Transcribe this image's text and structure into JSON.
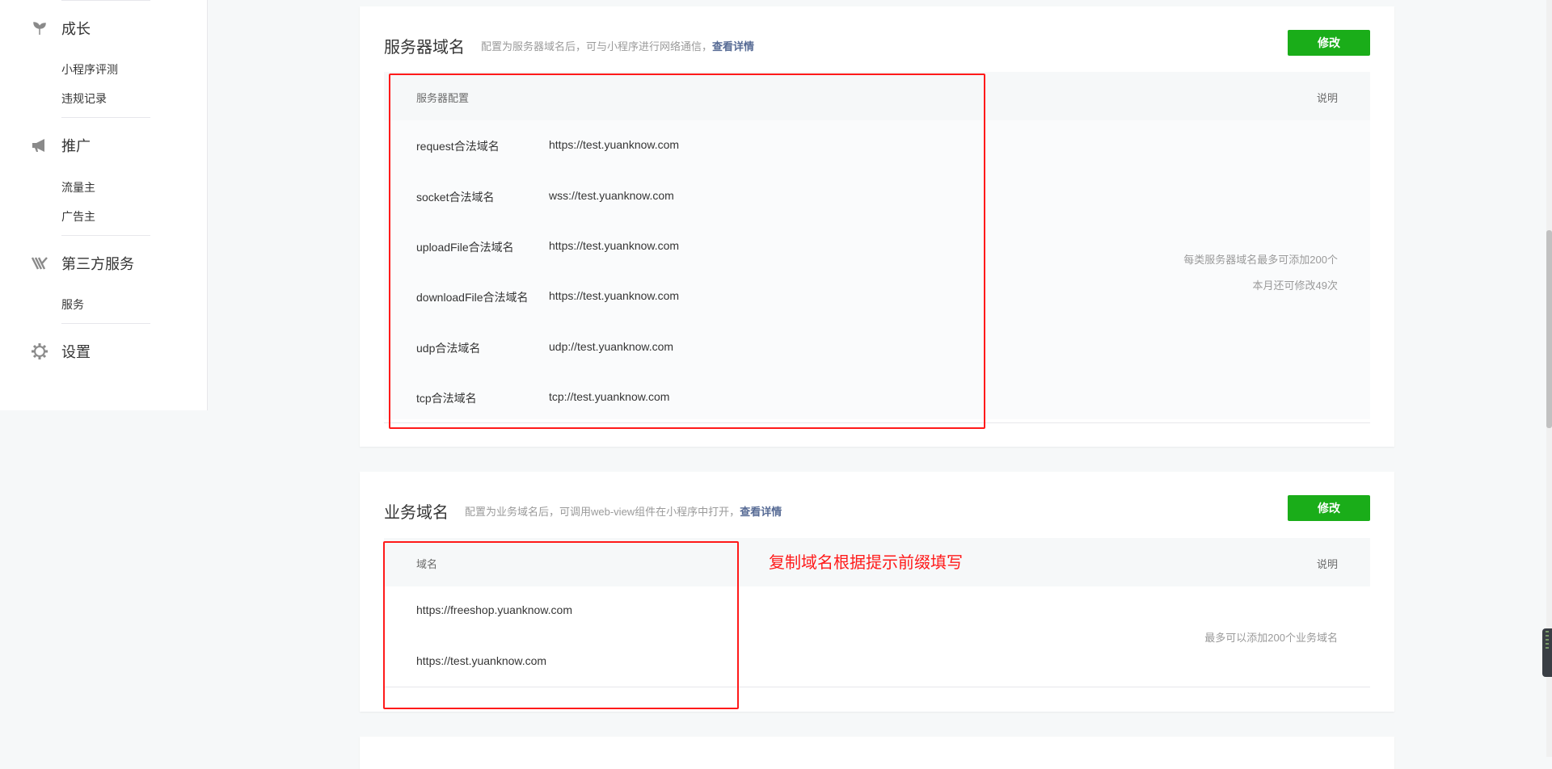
{
  "sidebar": {
    "groups": [
      {
        "title": "成长",
        "icon": "sprout-icon",
        "items": [
          "小程序评测",
          "违规记录"
        ]
      },
      {
        "title": "推广",
        "icon": "megaphone-icon",
        "items": [
          "流量主",
          "广告主"
        ]
      },
      {
        "title": "第三方服务",
        "icon": "third-party-icon",
        "items": [
          "服务"
        ]
      },
      {
        "title": "设置",
        "icon": "gear-icon",
        "items": []
      }
    ]
  },
  "server_domain": {
    "title": "服务器域名",
    "desc": "配置为服务器域名后，可与小程序进行网络通信，",
    "link": "查看详情",
    "button": "修改",
    "header_left": "服务器配置",
    "header_right": "说明",
    "rows": [
      {
        "label": "request合法域名",
        "value": "https://test.yuanknow.com"
      },
      {
        "label": "socket合法域名",
        "value": "wss://test.yuanknow.com"
      },
      {
        "label": "uploadFile合法域名",
        "value": "https://test.yuanknow.com"
      },
      {
        "label": "downloadFile合法域名",
        "value": "https://test.yuanknow.com"
      },
      {
        "label": "udp合法域名",
        "value": "udp://test.yuanknow.com"
      },
      {
        "label": "tcp合法域名",
        "value": "tcp://test.yuanknow.com"
      }
    ],
    "note_line1": "每类服务器域名最多可添加200个",
    "note_line2": "本月还可修改49次"
  },
  "business_domain": {
    "title": "业务域名",
    "desc": "配置为业务域名后，可调用web-view组件在小程序中打开，",
    "link": "查看详情",
    "button": "修改",
    "header_left": "域名",
    "header_right": "说明",
    "rows": [
      "https://freeshop.yuanknow.com",
      "https://test.yuanknow.com"
    ],
    "note": "最多可以添加200个业务域名",
    "annotation": "复制域名根据提示前缀填写"
  },
  "colors": {
    "accent_green": "#1aad19",
    "link": "#576b95",
    "annotation_red": "#ff1a1a"
  }
}
